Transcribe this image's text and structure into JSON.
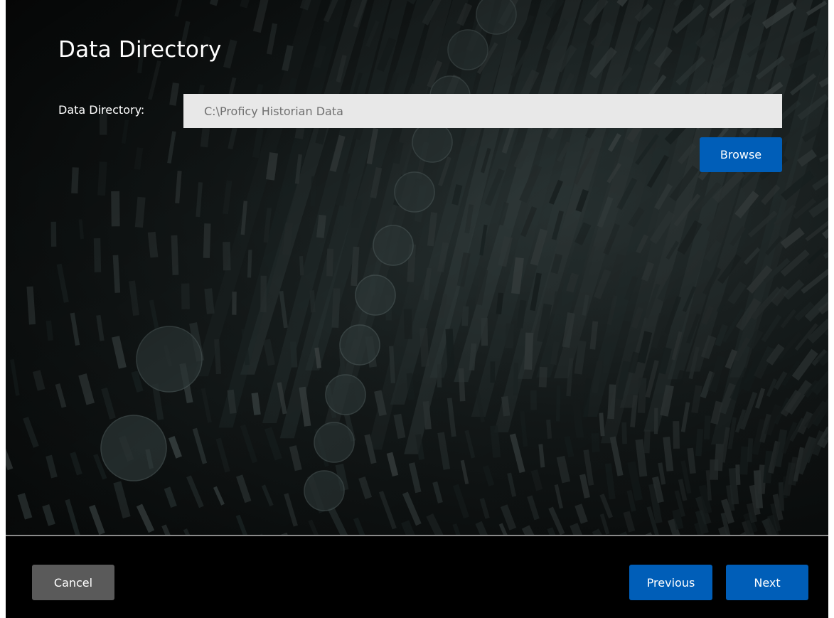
{
  "page": {
    "title": "Data Directory"
  },
  "form": {
    "directory_label": "Data Directory:",
    "directory_value": "C:\\Proficy Historian Data"
  },
  "buttons": {
    "browse": "Browse",
    "cancel": "Cancel",
    "previous": "Previous",
    "next": "Next"
  },
  "colors": {
    "primary_button": "#005eb8",
    "secondary_button": "#5a5a5a",
    "input_background": "#e8e8e8",
    "window_background": "#000000"
  }
}
